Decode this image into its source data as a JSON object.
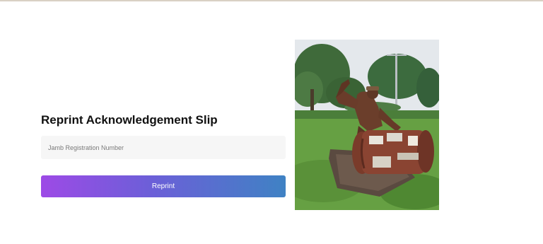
{
  "form": {
    "title": "Reprint Acknowledgement Slip",
    "registration_input": {
      "placeholder": "Jamb Registration Number",
      "value": ""
    },
    "reprint_button_label": "Reprint"
  },
  "photo": {
    "subject": "statue-of-man-with-drum"
  },
  "colors": {
    "button_gradient_start": "#9d4ae6",
    "button_gradient_end": "#3f82c4",
    "input_background": "#f6f6f6"
  }
}
